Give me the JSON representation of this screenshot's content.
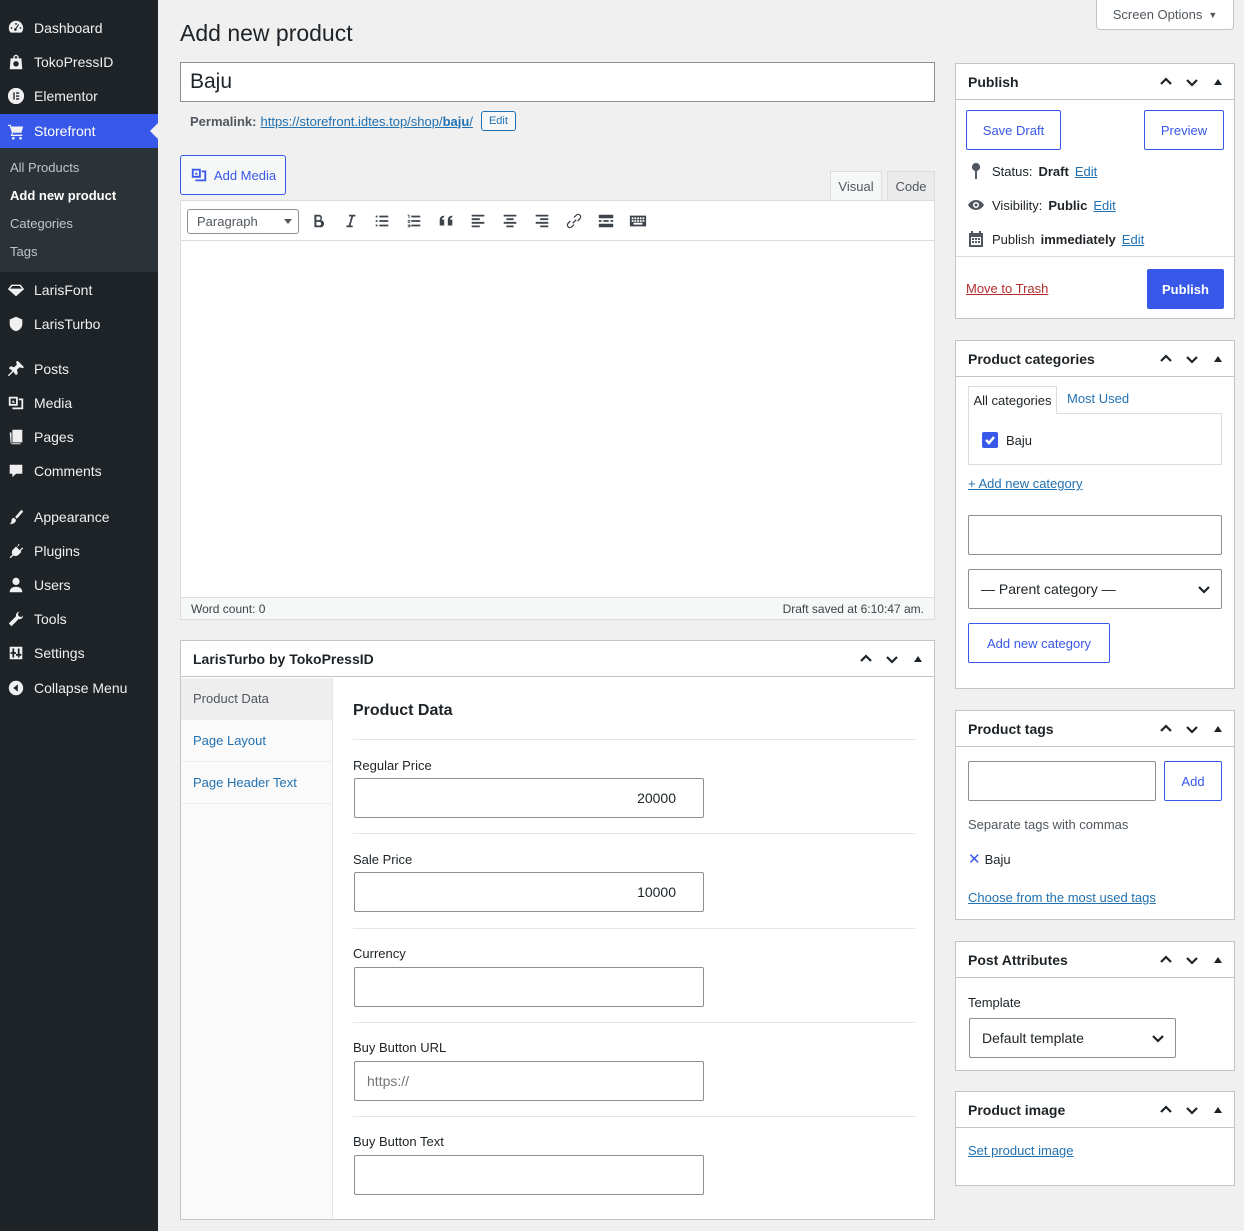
{
  "sidebar": {
    "items": [
      {
        "label": "Dashboard",
        "icon": "dashboard-icon"
      },
      {
        "label": "TokoPressID",
        "icon": "bag-icon"
      },
      {
        "label": "Elementor",
        "icon": "elementor-icon"
      },
      {
        "label": "Storefront",
        "icon": "cart-icon"
      },
      {
        "label": "LarisFont",
        "icon": "diamond-icon"
      },
      {
        "label": "LarisTurbo",
        "icon": "turbo-icon"
      },
      {
        "label": "Posts",
        "icon": "pin-icon"
      },
      {
        "label": "Media",
        "icon": "media-icon"
      },
      {
        "label": "Pages",
        "icon": "pages-icon"
      },
      {
        "label": "Comments",
        "icon": "comment-icon"
      },
      {
        "label": "Appearance",
        "icon": "brush-icon"
      },
      {
        "label": "Plugins",
        "icon": "plugin-icon"
      },
      {
        "label": "Users",
        "icon": "user-icon"
      },
      {
        "label": "Tools",
        "icon": "wrench-icon"
      },
      {
        "label": "Settings",
        "icon": "settings-icon"
      },
      {
        "label": "Collapse Menu",
        "icon": "collapse-icon"
      }
    ],
    "submenu": [
      "All Products",
      "Add new product",
      "Categories",
      "Tags"
    ]
  },
  "top": {
    "screen_options": "Screen Options"
  },
  "page": {
    "title": "Add new product"
  },
  "post": {
    "title_value": "Baju",
    "permalink_label": "Permalink:",
    "permalink_base": "https://storefront.idtes.top/shop/",
    "permalink_slug": "baju",
    "permalink_end": "/",
    "edit_label": "Edit"
  },
  "editor": {
    "add_media": "Add Media",
    "tab_visual": "Visual",
    "tab_code": "Code",
    "format": "Paragraph",
    "word_count": "Word count: 0",
    "draft_saved": "Draft saved at 6:10:47 am."
  },
  "laris": {
    "title": "LarisTurbo by TokoPressID",
    "tabs": [
      "Product Data",
      "Page Layout",
      "Page Header Text"
    ],
    "section_title": "Product Data",
    "fields": [
      {
        "label": "Regular Price",
        "value": "20000",
        "placeholder": ""
      },
      {
        "label": "Sale Price",
        "value": "10000",
        "placeholder": ""
      },
      {
        "label": "Currency",
        "value": "",
        "placeholder": ""
      },
      {
        "label": "Buy Button URL",
        "value": "",
        "placeholder": "https://"
      },
      {
        "label": "Buy Button Text",
        "value": "",
        "placeholder": ""
      }
    ]
  },
  "publish": {
    "title": "Publish",
    "save_draft": "Save Draft",
    "preview": "Preview",
    "status_label": "Status:",
    "status_value": "Draft",
    "visibility_label": "Visibility:",
    "visibility_value": "Public",
    "publish_label": "Publish",
    "publish_value": "immediately",
    "edit": "Edit",
    "move_to_trash": "Move to Trash",
    "publish_button": "Publish"
  },
  "categories": {
    "title": "Product categories",
    "tab_all": "All categories",
    "tab_most_used": "Most Used",
    "items": [
      {
        "label": "Baju",
        "checked": true
      }
    ],
    "add_new_link": "+ Add new category",
    "parent_select": "— Parent category —",
    "add_new_button": "Add new category"
  },
  "tags": {
    "title": "Product tags",
    "add_button": "Add",
    "hint": "Separate tags with commas",
    "items": [
      "Baju"
    ],
    "choose_link": "Choose from the most used tags"
  },
  "attributes": {
    "title": "Post Attributes",
    "template_label": "Template",
    "template_value": "Default template"
  },
  "image": {
    "title": "Product image",
    "set_link": "Set product image"
  },
  "colors": {
    "accent": "#3858e9",
    "sidebar_bg": "#1d2327",
    "link": "#2271b1",
    "trash": "#b32d2e"
  }
}
